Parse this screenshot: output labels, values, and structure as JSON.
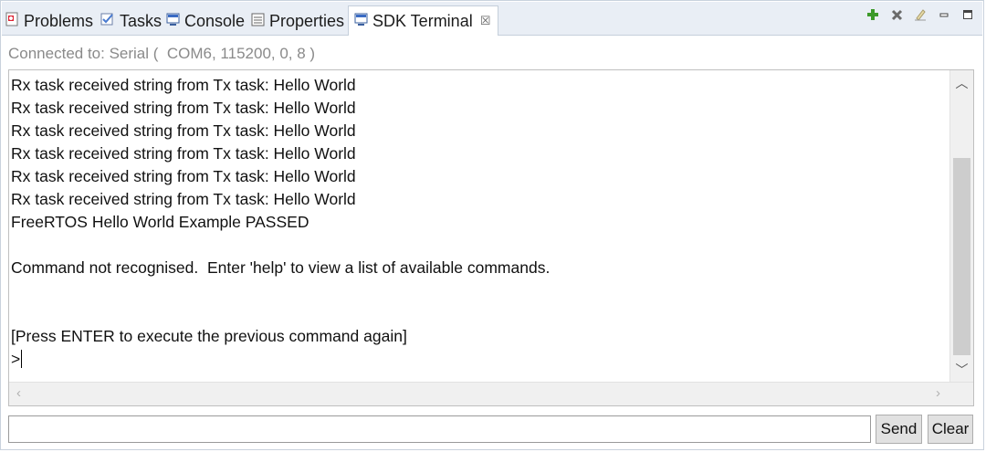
{
  "tabs": [
    {
      "label": "Problems",
      "icon": "problems-icon"
    },
    {
      "label": "Tasks",
      "icon": "tasks-icon"
    },
    {
      "label": "Console",
      "icon": "console-icon"
    },
    {
      "label": "Properties",
      "icon": "properties-icon"
    },
    {
      "label": "SDK Terminal",
      "icon": "terminal-icon",
      "active": true
    }
  ],
  "toolbar": {
    "icons": [
      "add-icon",
      "remove-icon",
      "clear-icon",
      "minimize-icon",
      "maximize-icon"
    ],
    "accent_add": "#3c9a2a",
    "accent_remove": "#6b6b6b"
  },
  "connection": {
    "status": "Connected to: Serial (  COM6, 115200, 0, 8 )"
  },
  "terminal": {
    "lines": [
      "Rx task received string from Tx task: Hello World",
      "Rx task received string from Tx task: Hello World",
      "Rx task received string from Tx task: Hello World",
      "Rx task received string from Tx task: Hello World",
      "Rx task received string from Tx task: Hello World",
      "Rx task received string from Tx task: Hello World",
      "FreeRTOS Hello World Example PASSED",
      "",
      "Command not recognised.  Enter 'help' to view a list of available commands.",
      "",
      "",
      "[Press ENTER to execute the previous command again]",
      ">"
    ]
  },
  "input": {
    "value": "",
    "placeholder": ""
  },
  "buttons": {
    "send": "Send",
    "clear": "Clear"
  }
}
